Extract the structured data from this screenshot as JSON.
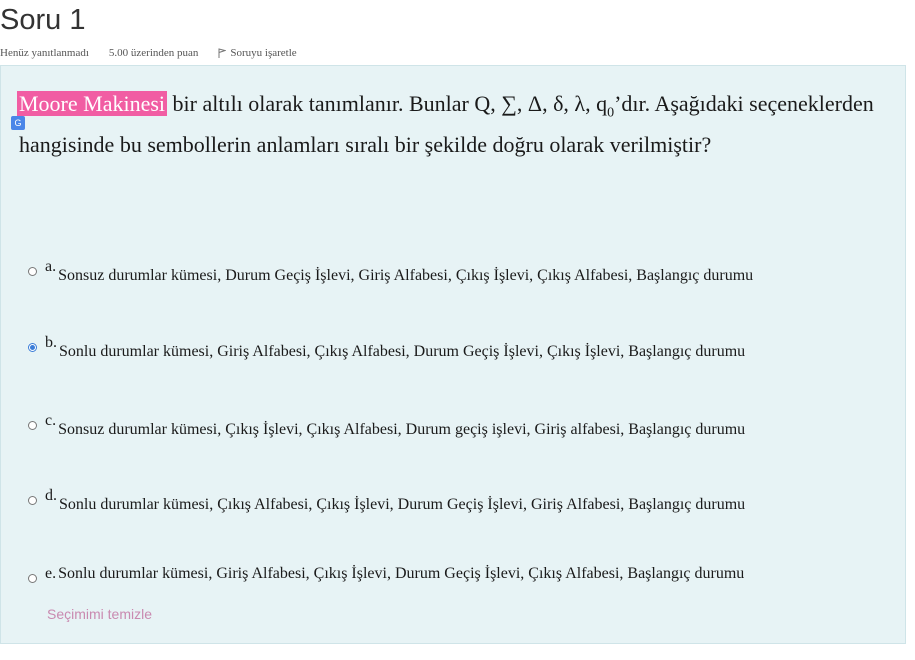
{
  "question": {
    "title": "Soru 1",
    "status": "Henüz yanıtlanmadı",
    "points": "5.00 üzerinden puan",
    "flag_label": "Soruyu işaretle",
    "highlight": "Moore Makinesi",
    "text_rest": " bir altılı olarak tanımlanır. Bunlar Q, ∑, Δ, δ, λ, q",
    "text_sub": "0",
    "text_end": "’dır. Aşağıdaki seçeneklerden hangisinde bu sembollerin anlamları sıralı bir şekilde doğru olarak verilmiştir?",
    "options": [
      {
        "letter": "a.",
        "text": "Sonsuz durumlar kümesi, Durum Geçiş İşlevi, Giriş Alfabesi, Çıkış İşlevi, Çıkış Alfabesi, Başlangıç durumu",
        "checked": false
      },
      {
        "letter": "b.",
        "text": "Sonlu durumlar kümesi, Giriş Alfabesi, Çıkış Alfabesi, Durum Geçiş İşlevi, Çıkış İşlevi, Başlangıç durumu",
        "checked": true
      },
      {
        "letter": "c.",
        "text": "Sonsuz durumlar kümesi, Çıkış İşlevi, Çıkış Alfabesi, Durum geçiş işlevi, Giriş alfabesi, Başlangıç durumu",
        "checked": false
      },
      {
        "letter": "d.",
        "text": "Sonlu durumlar kümesi, Çıkış Alfabesi, Çıkış İşlevi, Durum Geçiş İşlevi, Giriş Alfabesi, Başlangıç durumu",
        "checked": false
      },
      {
        "letter": "e.",
        "text": "Sonlu durumlar kümesi, Giriş Alfabesi, Çıkış İşlevi, Durum Geçiş İşlevi, Çıkış Alfabesi, Başlangıç durumu",
        "checked": false
      }
    ],
    "clear_label": "Seçimimi temizle",
    "colors": {
      "highlight": "#f15da3",
      "panel": "#e7f3f5",
      "radio_selected": "#3b7dd8",
      "clear_link": "#c98ab0"
    }
  }
}
